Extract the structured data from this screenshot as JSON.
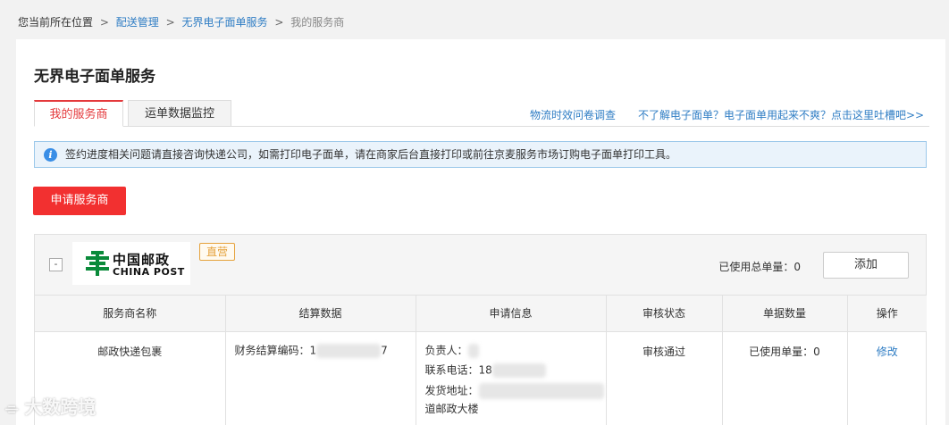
{
  "breadcrumb": {
    "prefix": "您当前所在位置",
    "sep": ">",
    "items": [
      "配送管理",
      "无界电子面单服务"
    ],
    "current": "我的服务商"
  },
  "page": {
    "title": "无界电子面单服务"
  },
  "tabs": [
    {
      "label": "我的服务商",
      "active": true
    },
    {
      "label": "运单数据监控",
      "active": false
    }
  ],
  "links": {
    "survey": "物流时效问卷调查",
    "feedback": "不了解电子面单？电子面单用起来不爽？点击这里吐槽吧>>"
  },
  "notice": {
    "icon": "info-icon",
    "text": "签约进度相关问题请直接咨询快递公司，如需打印电子面单，请在商家后台直接打印或前往京麦服务市场订购电子面单打印工具。"
  },
  "apply_button": "申请服务商",
  "provider": {
    "collapse_symbol": "-",
    "logo_cn": "中国邮政",
    "logo_en": "CHINA POST",
    "tag": "直营",
    "used_total": "已使用总单量：0",
    "add_button": "添加",
    "columns": [
      "服务商名称",
      "结算数据",
      "申请信息",
      "审核状态",
      "单据数量",
      "操作"
    ],
    "row": {
      "name": "邮政快递包裹",
      "settlement_label": "财务结算编码：1",
      "settlement_tail": "7",
      "contact_label": "负责人：",
      "phone_label": "联系电话：18",
      "address_label": "发货地址：",
      "address_tail": "道邮政大楼",
      "status": "审核通过",
      "count": "已使用单量：0",
      "action": "修改"
    }
  },
  "watermark": "大数跨境",
  "colors": {
    "accent": "#e4393c",
    "link": "#2f7dc4",
    "tag": "#e5a23c",
    "logo_green": "#0a8a3a"
  }
}
